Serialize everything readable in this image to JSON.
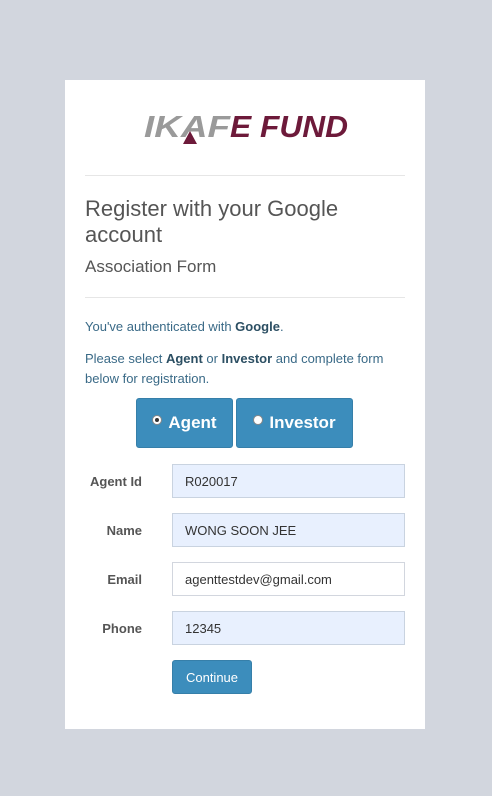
{
  "brand": {
    "logo_text": "KAF E FUND"
  },
  "header": {
    "title": "Register with your Google account",
    "subtitle": "Association Form"
  },
  "auth": {
    "prefix": "You've authenticated with ",
    "provider": "Google",
    "suffix": "."
  },
  "instructions": {
    "part1": "Please select ",
    "agent_word": "Agent",
    "part2": " or ",
    "investor_word": "Investor",
    "part3": " and complete form below for registration."
  },
  "role_selector": {
    "agent_label": "Agent",
    "investor_label": "Investor",
    "selected": "Agent"
  },
  "form": {
    "agent_id": {
      "label": "Agent Id",
      "value": "R020017"
    },
    "name": {
      "label": "Name",
      "value": "WONG SOON JEE"
    },
    "email": {
      "label": "Email",
      "value": "agenttestdev@gmail.com"
    },
    "phone": {
      "label": "Phone",
      "value": "12345"
    }
  },
  "actions": {
    "continue_label": "Continue"
  },
  "colors": {
    "primary": "#3c8dbc",
    "brand_maroon": "#6d1a3a",
    "brand_grey": "#9a9a9a",
    "page_bg": "#d2d6de"
  }
}
